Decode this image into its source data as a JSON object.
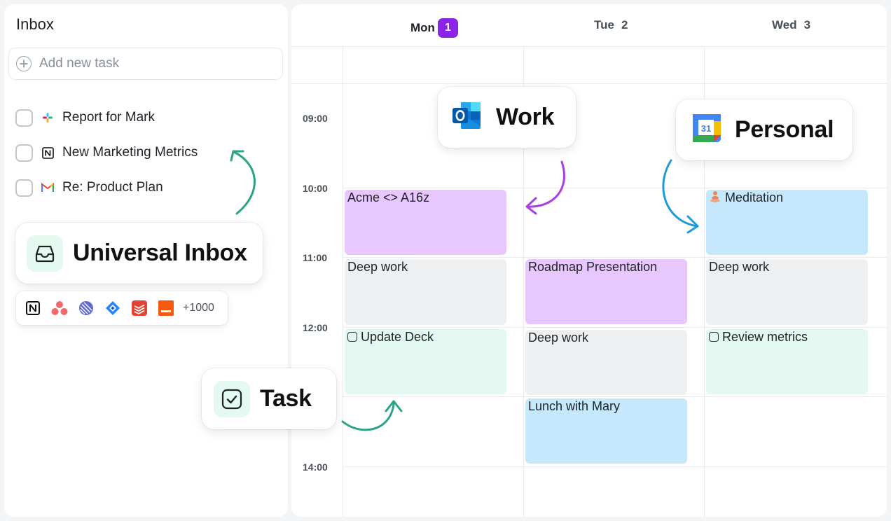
{
  "inbox": {
    "title": "Inbox",
    "add_placeholder": "Add new task",
    "tasks": [
      {
        "label": "Report for Mark",
        "source_icon": "slack-icon"
      },
      {
        "label": "New Marketing Metrics",
        "source_icon": "notion-icon"
      },
      {
        "label": "Re: Product Plan",
        "source_icon": "gmail-icon"
      }
    ]
  },
  "calendar": {
    "days": [
      {
        "name": "Mon",
        "num": "1",
        "today": true
      },
      {
        "name": "Tue",
        "num": "2",
        "today": false
      },
      {
        "name": "Wed",
        "num": "3",
        "today": false
      }
    ],
    "times": [
      "09:00",
      "10:00",
      "11:00",
      "12:00",
      "14:00"
    ],
    "events": {
      "acme": "Acme <> A16z",
      "meditation": "Meditation",
      "mon_deep": "Deep work",
      "roadmap": "Roadmap Presentation",
      "wed_deep": "Deep work",
      "update_deck": "Update Deck",
      "tue_deep": "Deep work",
      "review_metrics": "Review metrics",
      "lunch": "Lunch with Mary"
    },
    "colors": {
      "today_badge": "#8b24e8",
      "work_event": "#e8c7ff",
      "personal_event": "#c5e8fd",
      "task_event": "#e3f8f0",
      "focus_event": "#eeeff1"
    }
  },
  "cards": {
    "work": "Work",
    "personal": "Personal",
    "universal_inbox": "Universal Inbox",
    "task": "Task"
  },
  "integrations": {
    "icons": [
      "notion-icon",
      "asana-icon",
      "linear-icon",
      "jira-icon",
      "todoist-icon",
      "clickup-icon"
    ],
    "more": "+1000"
  },
  "arrow_colors": {
    "inbox": "#2aa387",
    "work": "#a93ee6",
    "personal": "#1e9ad8",
    "task": "#2aa387"
  }
}
